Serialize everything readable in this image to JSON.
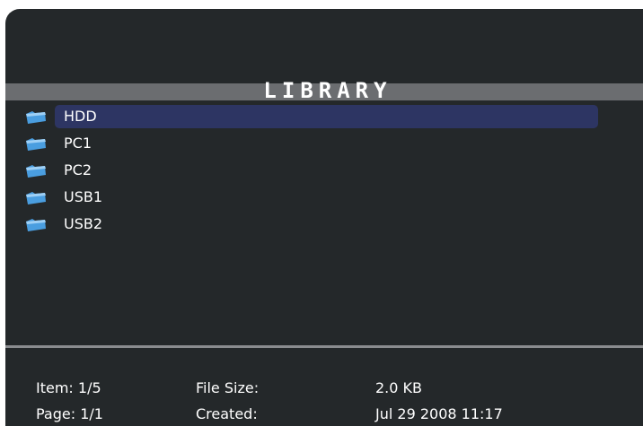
{
  "header": {
    "title": "LIBRARY"
  },
  "library": {
    "items": [
      {
        "label": "HDD",
        "icon": "folder-icon",
        "selected": true
      },
      {
        "label": "PC1",
        "icon": "folder-icon",
        "selected": false
      },
      {
        "label": "PC2",
        "icon": "folder-icon",
        "selected": false
      },
      {
        "label": "USB1",
        "icon": "folder-icon",
        "selected": false
      },
      {
        "label": "USB2",
        "icon": "folder-icon",
        "selected": false
      }
    ]
  },
  "info": {
    "item_label": "Item: 1/5",
    "page_label": "Page: 1/1",
    "file_size_label": "File Size:",
    "file_size_value": "2.0 KB",
    "created_label": "Created:",
    "created_value": "Jul 29 2008 11:17"
  },
  "colors": {
    "background": "#24282a",
    "title_bar": "#6b6d70",
    "selection": "#2d3563",
    "folder_icon": "#4a9ee0"
  }
}
